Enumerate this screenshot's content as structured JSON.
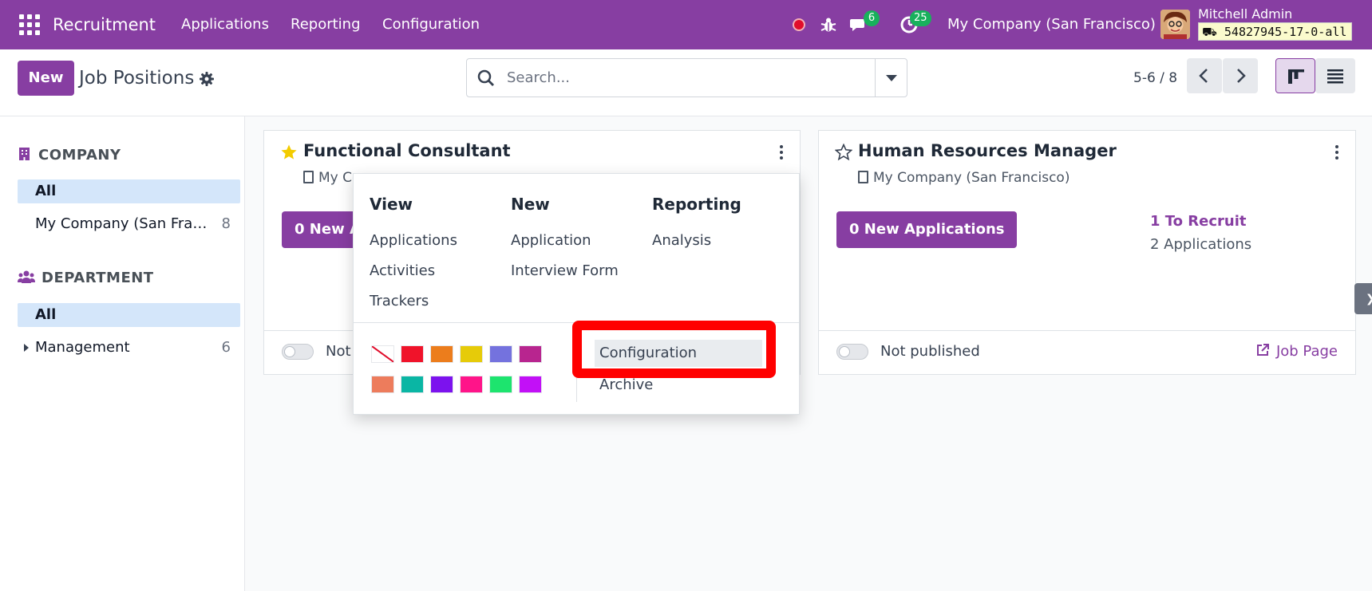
{
  "navbar": {
    "app_name": "Recruitment",
    "menu": [
      "Applications",
      "Reporting",
      "Configuration"
    ],
    "messages_count": "6",
    "activities_count": "25",
    "company": "My Company (San Francisco)",
    "user": "Mitchell Admin",
    "database": "54827945-17-0-all"
  },
  "control": {
    "new_label": "New",
    "title": "Job Positions",
    "search_placeholder": "Search...",
    "pager": "5-6 / 8"
  },
  "sidebar": {
    "company_title": "COMPANY",
    "company_facets": [
      {
        "label": "All",
        "count": ""
      },
      {
        "label": "My Company (San Francisco)",
        "count": "8"
      }
    ],
    "department_title": "DEPARTMENT",
    "department_facets": [
      {
        "label": "All",
        "count": ""
      },
      {
        "label": "Management",
        "count": "6"
      }
    ]
  },
  "cards": [
    {
      "title": "Functional Consultant",
      "company": "My Co",
      "cta": "0 New A",
      "status": "Not",
      "favorite": true
    },
    {
      "title": "Human Resources Manager",
      "company": "My Company (San Francisco)",
      "cta": "0 New Applications",
      "to_recruit": "1 To Recruit",
      "applications": "2 Applications",
      "status": "Not published",
      "job_page": "Job Page",
      "favorite": false
    }
  ],
  "dropdown": {
    "view_title": "View",
    "view_items": [
      "Applications",
      "Activities",
      "Trackers"
    ],
    "new_title": "New",
    "new_items": [
      "Application",
      "Interview Form"
    ],
    "reporting_title": "Reporting",
    "reporting_items": [
      "Analysis"
    ],
    "configuration": "Configuration",
    "archive": "Archive",
    "colors": [
      "#ffffff",
      "#f0132a",
      "#ec7d1c",
      "#e6cb09",
      "#7472de",
      "#b8258f",
      "#ed7c5c",
      "#0ab6a4",
      "#7c12ee",
      "#ff1489",
      "#1de46e",
      "#c210f7"
    ]
  },
  "theme": {
    "primary": "#873ea2",
    "highlight": "#ff0000"
  }
}
